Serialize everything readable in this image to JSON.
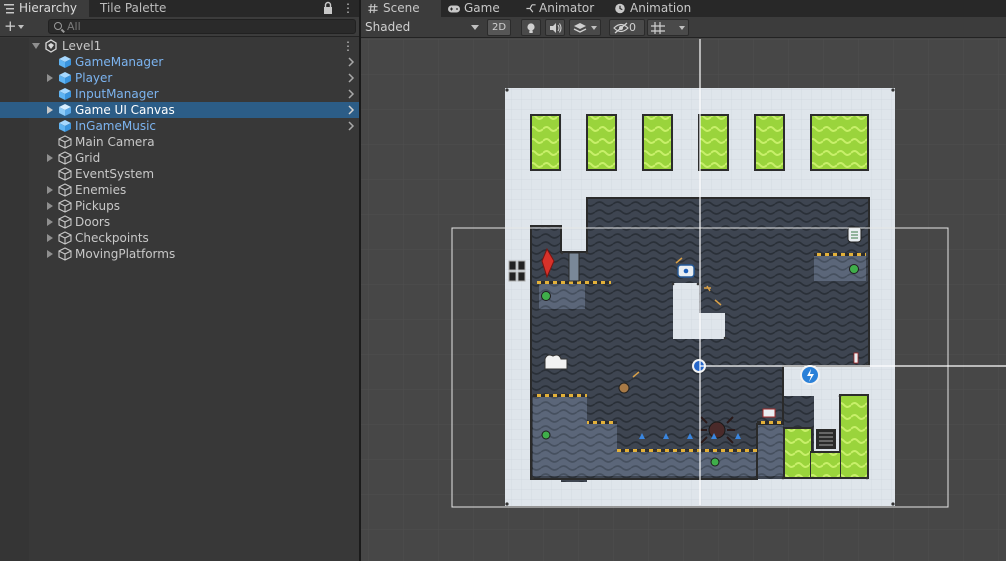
{
  "hierarchy": {
    "tab_hierarchy": "Hierarchy",
    "tab_tile_palette": "Tile Palette",
    "search_placeholder": "All",
    "add_label": "+",
    "items": [
      {
        "label": "Level1",
        "type": "scene"
      },
      {
        "label": "GameManager",
        "type": "prefab"
      },
      {
        "label": "Player",
        "type": "prefab"
      },
      {
        "label": "InputManager",
        "type": "prefab"
      },
      {
        "label": "Game UI Canvas",
        "type": "prefab",
        "selected": true
      },
      {
        "label": "InGameMusic",
        "type": "prefab"
      },
      {
        "label": "Main Camera",
        "type": "object"
      },
      {
        "label": "Grid",
        "type": "object"
      },
      {
        "label": "EventSystem",
        "type": "object"
      },
      {
        "label": "Enemies",
        "type": "object"
      },
      {
        "label": "Pickups",
        "type": "object"
      },
      {
        "label": "Doors",
        "type": "object"
      },
      {
        "label": "Checkpoints",
        "type": "object"
      },
      {
        "label": "MovingPlatforms",
        "type": "object"
      }
    ]
  },
  "scene": {
    "tab_scene": "Scene",
    "tab_game": "Game",
    "tab_animator": "Animator",
    "tab_animation": "Animation",
    "shading_mode": "Shaded",
    "btn_2d": "2D",
    "hidden_count": "0",
    "colors": {
      "toolbar_bg": "#3c3c3c",
      "viewport_bg": "#474747",
      "selected_row": "#2c5d87",
      "prefab_text": "#7cb4f0",
      "slime": "#a9e34b",
      "dark_tiles": "#3d4450",
      "background_tiles": "#dde3ea"
    }
  }
}
